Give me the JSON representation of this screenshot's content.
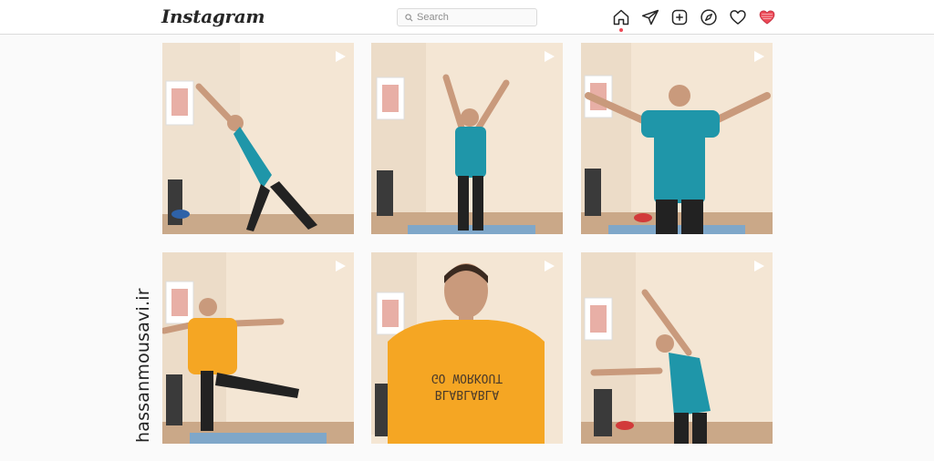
{
  "app": {
    "brand": "Instagram",
    "accent_color": "#ed4956"
  },
  "search": {
    "placeholder": "Search"
  },
  "nav": {
    "icons": [
      "home-icon",
      "direct-messages-icon",
      "new-post-icon",
      "explore-icon",
      "activity-heart-icon",
      "profile-heart-icon"
    ],
    "active": "home"
  },
  "posts": [
    {
      "type": "video",
      "shirt_color": "#1f96a9"
    },
    {
      "type": "video",
      "shirt_color": "#1f96a9"
    },
    {
      "type": "video",
      "shirt_color": "#1f96a9"
    },
    {
      "type": "video",
      "shirt_color": "#f5a623"
    },
    {
      "type": "video",
      "shirt_color": "#f5a623",
      "shirt_text": "BLABLABLA GO WORKOUT"
    },
    {
      "type": "video",
      "shirt_color": "#1f96a9"
    }
  ],
  "watermark": {
    "text": "hassanmousavi.ir"
  }
}
